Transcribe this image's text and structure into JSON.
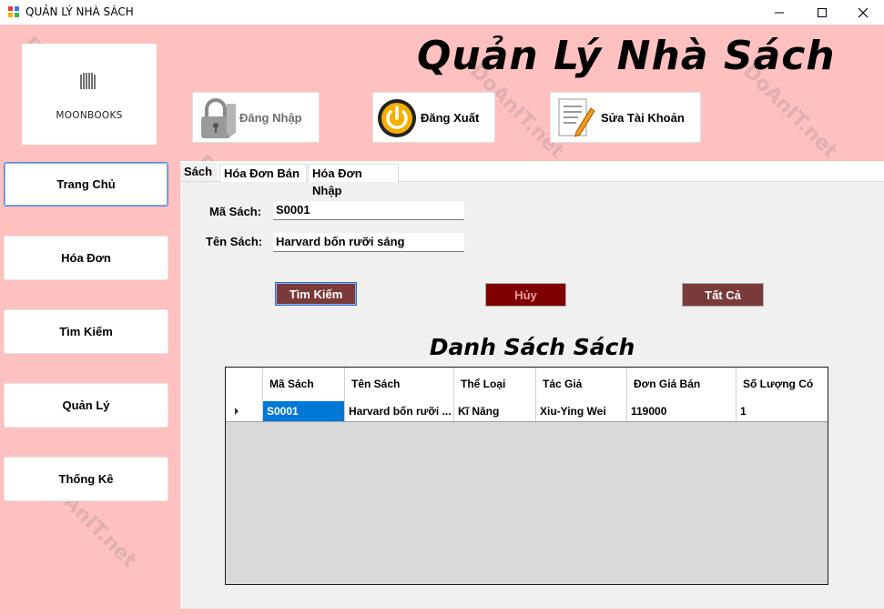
{
  "window": {
    "title": "QUẢN LÝ NHÀ SÁCH",
    "minimize_icon": "minimize-icon",
    "maximize_icon": "maximize-icon",
    "close_icon": "close-icon"
  },
  "logo": {
    "text": "MOONBOOKS",
    "icon": "moon-book-logo"
  },
  "heading": "Quản Lý Nhà Sách",
  "top_buttons": {
    "login": {
      "label": "Đăng Nhập",
      "icon": "lock-icon"
    },
    "logout": {
      "label": "Đăng Xuất",
      "icon": "power-icon"
    },
    "edit_account": {
      "label": "Sửa Tài Khoản",
      "icon": "edit-document-icon"
    }
  },
  "sidebar": {
    "items": [
      {
        "label": "Trang Chủ"
      },
      {
        "label": "Hóa Đơn"
      },
      {
        "label": "Tìm Kiếm"
      },
      {
        "label": "Quản Lý"
      },
      {
        "label": "Thống Kê"
      }
    ]
  },
  "tabs": [
    {
      "label": "Sách"
    },
    {
      "label": "Hóa Đơn Bán"
    },
    {
      "label": "Hóa Đơn Nhập"
    }
  ],
  "form": {
    "ma_sach_label": "Mã Sách:",
    "ma_sach_value": "S0001",
    "ten_sach_label": "Tên Sách:",
    "ten_sach_value": "Harvard bốn rưỡi sáng"
  },
  "actions": {
    "search": "Tìm Kiếm",
    "cancel": "Hủy",
    "all": "Tất Cả"
  },
  "list_title": "Danh Sách Sách",
  "table": {
    "columns": [
      "Mã Sách",
      "Tên Sách",
      "Thể Loại",
      "Tác Giả",
      "Đơn Giá Bán",
      "Số Lượng Có"
    ],
    "rows": [
      [
        "S0001",
        "Harvard bốn rưỡi ...",
        "Kĩ Năng",
        "Xiu-Ying Wei",
        "119000",
        "1"
      ]
    ]
  },
  "watermark": "DoAnIT.net",
  "colors": {
    "background": "#ffc0c0",
    "button_red": "#7b3a3a",
    "cancel_red": "#800000",
    "selection_blue": "#0078d7"
  }
}
